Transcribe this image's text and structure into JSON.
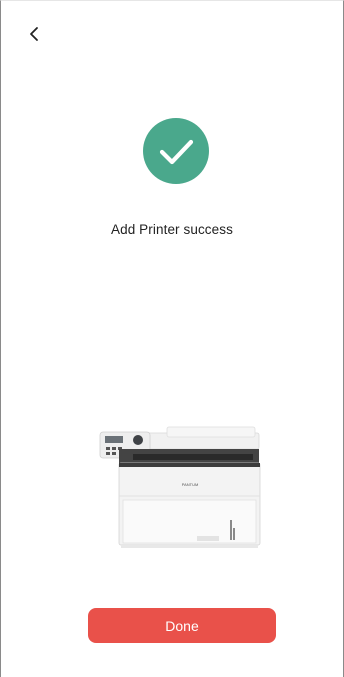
{
  "header": {
    "back_icon": "chevron-left-icon"
  },
  "status": {
    "icon": "check-circle-icon",
    "icon_color": "#4aa88c",
    "message": "Add Printer success"
  },
  "printer": {
    "image": "printer-illustration",
    "brand_label": "PANTUM"
  },
  "actions": {
    "done_label": "Done",
    "done_color": "#e9514a"
  }
}
